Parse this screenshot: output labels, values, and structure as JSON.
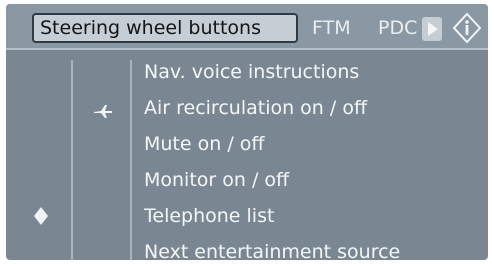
{
  "tabs": {
    "active": "Steering wheel buttons",
    "ftm": "FTM",
    "pdc": "PDC"
  },
  "icons": {
    "next_tab": "play-arrow-icon",
    "info": "info-icon",
    "airplane": "airplane-icon",
    "diamond": "diamond-icon"
  },
  "menu": {
    "items": [
      "Nav. voice instructions",
      "Air recirculation on / off",
      "Mute on / off",
      "Monitor on / off",
      "Telephone list",
      "Next entertainment source"
    ]
  }
}
